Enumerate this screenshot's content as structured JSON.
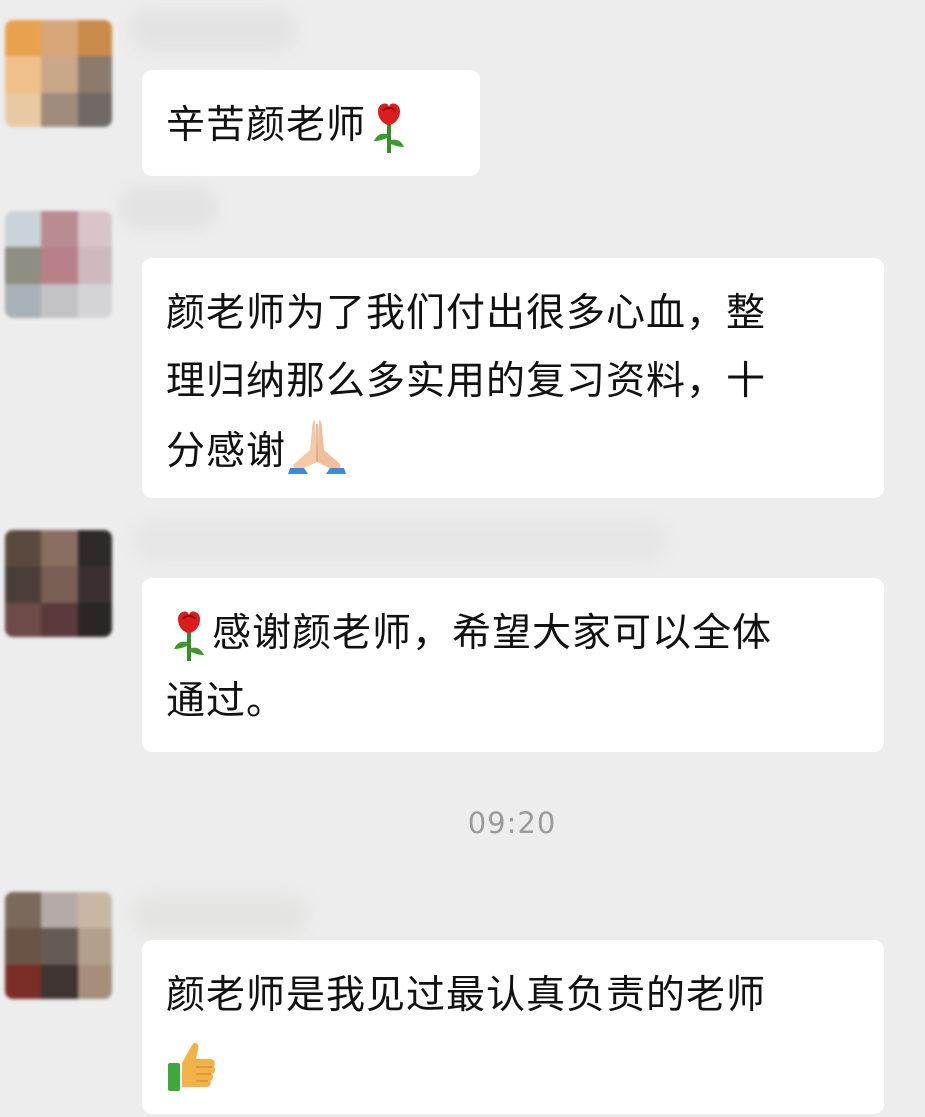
{
  "messages": [
    {
      "text": "辛苦颜老师",
      "emoji_after": "rose-icon"
    },
    {
      "text": "颜老师为了我们付出很多心血，整\n理归纳那么多实用的复习资料，十\n分感谢",
      "emoji_after": "folded-hands-icon"
    },
    {
      "emoji_before": "rose-icon",
      "text": "感谢颜老师，希望大家可以全体\n通过。"
    },
    {
      "text": "颜老师是我见过最认真负责的老师\n",
      "emoji_after": "thumbs-up-icon"
    }
  ],
  "timestamp": "09:20",
  "colors": {
    "background": "#ededed",
    "bubble": "#ffffff",
    "timestamp": "#9b9b9b"
  }
}
